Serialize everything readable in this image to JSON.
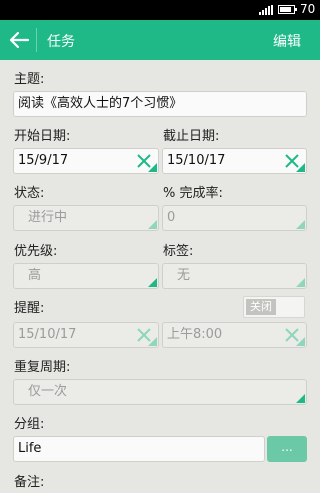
{
  "status_bar": {
    "battery": "70"
  },
  "header": {
    "title": "任务",
    "edit_label": "编辑"
  },
  "form": {
    "subject_label": "主题:",
    "subject_value": "阅读《高效人士的7个习惯》",
    "start_label": "开始日期:",
    "start_value": "15/9/17",
    "end_label": "截止日期:",
    "end_value": "15/10/17",
    "status_label": "状态:",
    "status_value": "进行中",
    "percent_label": "% 完成率:",
    "percent_value": "0",
    "priority_label": "优先级:",
    "priority_value": "高",
    "tags_label": "标签:",
    "tags_value": "无",
    "reminder_label": "提醒:",
    "reminder_toggle": "关闭",
    "reminder_date": "15/10/17",
    "reminder_time": "上午8:00",
    "repeat_label": "重复周期:",
    "repeat_value": "仅一次",
    "group_label": "分组:",
    "group_value": "Life",
    "group_more": "...",
    "notes_label": "备注:"
  },
  "colors": {
    "accent": "#1fb987",
    "background": "#e6e6e2"
  }
}
